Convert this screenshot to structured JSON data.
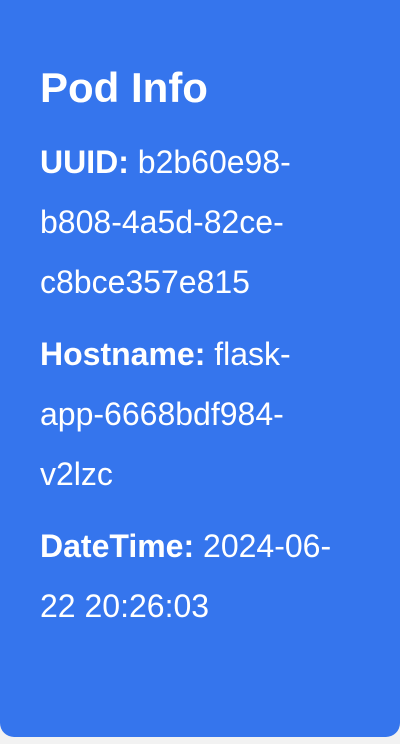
{
  "header": {
    "title": "Pod Info"
  },
  "fields": [
    {
      "label": "UUID:",
      "value": "b2b60e98-b808-4a5d-82ce-c8bce357e815"
    },
    {
      "label": "Hostname:",
      "value": "flask-app-6668bdf984-v2lzc"
    },
    {
      "label": "DateTime:",
      "value": "2024-06-22 20:26:03"
    }
  ],
  "colors": {
    "card_background": "#3575ed",
    "text": "#ffffff",
    "page_background": "#f2f2f2"
  }
}
